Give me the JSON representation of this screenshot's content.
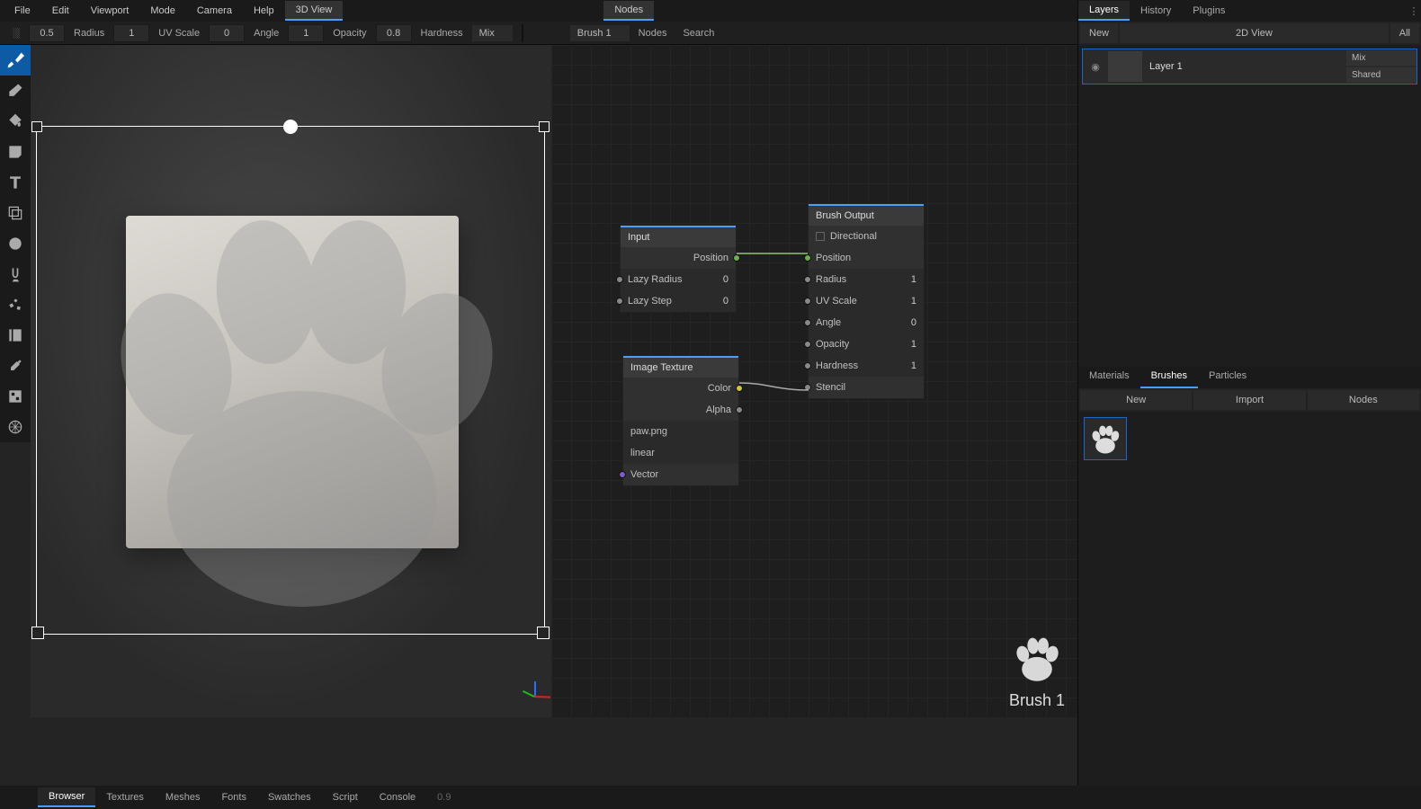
{
  "menubar": {
    "items": [
      "File",
      "Edit",
      "Viewport",
      "Mode",
      "Camera",
      "Help"
    ],
    "view_tab": "3D View",
    "nodes_tab": "Nodes"
  },
  "propsbar": {
    "val1": "0.5",
    "radius": "Radius",
    "radius_v": "1",
    "uvscale": "UV Scale",
    "uvscale_v": "0",
    "angle": "Angle",
    "angle_v": "1",
    "opacity": "Opacity",
    "opacity_v": "0.8",
    "hardness": "Hardness",
    "mix": "Mix",
    "brush": "Brush 1",
    "nodes": "Nodes",
    "search": "Search"
  },
  "nodes": {
    "input": {
      "title": "Input",
      "position": "Position",
      "lazyradius": "Lazy Radius",
      "lazyradius_v": "0",
      "lazystep": "Lazy Step",
      "lazystep_v": "0"
    },
    "imgtex": {
      "title": "Image Texture",
      "color": "Color",
      "alpha": "Alpha",
      "file": "paw.png",
      "filter": "linear",
      "vector": "Vector"
    },
    "output": {
      "title": "Brush Output",
      "directional": "Directional",
      "position": "Position",
      "radius": "Radius",
      "radius_v": "1",
      "uvscale": "UV Scale",
      "uvscale_v": "1",
      "angle": "Angle",
      "angle_v": "0",
      "opacity": "Opacity",
      "opacity_v": "1",
      "hardness": "Hardness",
      "hardness_v": "1",
      "stencil": "Stencil"
    }
  },
  "right": {
    "tabs": [
      "Layers",
      "History",
      "Plugins"
    ],
    "sub": [
      "New",
      "2D View",
      "All"
    ],
    "layer": {
      "name": "Layer 1",
      "blend": "Mix",
      "shared": "Shared"
    },
    "libtabs": [
      "Materials",
      "Brushes",
      "Particles"
    ],
    "libsub": [
      "New",
      "Import",
      "Nodes"
    ]
  },
  "brush_preview": "Brush 1",
  "bottom": {
    "tabs": [
      "Browser",
      "Textures",
      "Meshes",
      "Fonts",
      "Swatches",
      "Script",
      "Console"
    ],
    "val": "0.9"
  }
}
